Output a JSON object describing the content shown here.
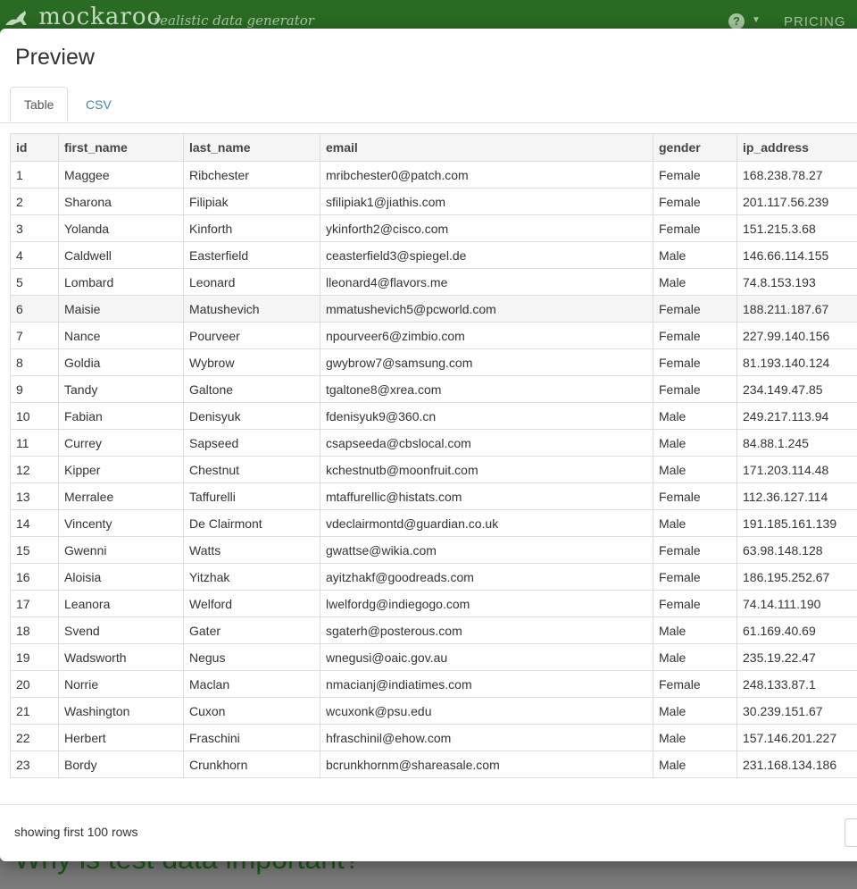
{
  "app": {
    "brand": "mockaroo",
    "tagline": "realistic data generator",
    "help_icon": "?",
    "pricing": "PRICING",
    "background_heading": "Why is test data important?"
  },
  "modal": {
    "title": "Preview",
    "tabs": [
      "Table",
      "CSV"
    ],
    "columns": [
      "id",
      "first_name",
      "last_name",
      "email",
      "gender",
      "ip_address"
    ],
    "rows": [
      [
        "1",
        "Maggee",
        "Ribchester",
        "mribchester0@patch.com",
        "Female",
        "168.238.78.27"
      ],
      [
        "2",
        "Sharona",
        "Filipiak",
        "sfilipiak1@jiathis.com",
        "Female",
        "201.117.56.239"
      ],
      [
        "3",
        "Yolanda",
        "Kinforth",
        "ykinforth2@cisco.com",
        "Female",
        "151.215.3.68"
      ],
      [
        "4",
        "Caldwell",
        "Easterfield",
        "ceasterfield3@spiegel.de",
        "Male",
        "146.66.114.155"
      ],
      [
        "5",
        "Lombard",
        "Leonard",
        "lleonard4@flavors.me",
        "Male",
        "74.8.153.193"
      ],
      [
        "6",
        "Maisie",
        "Matushevich",
        "mmatushevich5@pcworld.com",
        "Female",
        "188.211.187.67"
      ],
      [
        "7",
        "Nance",
        "Pourveer",
        "npourveer6@zimbio.com",
        "Female",
        "227.99.140.156"
      ],
      [
        "8",
        "Goldia",
        "Wybrow",
        "gwybrow7@samsung.com",
        "Female",
        "81.193.140.124"
      ],
      [
        "9",
        "Tandy",
        "Galtone",
        "tgaltone8@xrea.com",
        "Female",
        "234.149.47.85"
      ],
      [
        "10",
        "Fabian",
        "Denisyuk",
        "fdenisyuk9@360.cn",
        "Male",
        "249.217.113.94"
      ],
      [
        "11",
        "Currey",
        "Sapseed",
        "csapseeda@cbslocal.com",
        "Male",
        "84.88.1.245"
      ],
      [
        "12",
        "Kipper",
        "Chestnut",
        "kchestnutb@moonfruit.com",
        "Male",
        "171.203.114.48"
      ],
      [
        "13",
        "Merralee",
        "Taffurelli",
        "mtaffurellic@histats.com",
        "Female",
        "112.36.127.114"
      ],
      [
        "14",
        "Vincenty",
        "De Clairmont",
        "vdeclairmontd@guardian.co.uk",
        "Male",
        "191.185.161.139"
      ],
      [
        "15",
        "Gwenni",
        "Watts",
        "gwattse@wikia.com",
        "Female",
        "63.98.148.128"
      ],
      [
        "16",
        "Aloisia",
        "Yitzhak",
        "ayitzhakf@goodreads.com",
        "Female",
        "186.195.252.67"
      ],
      [
        "17",
        "Leanora",
        "Welford",
        "lwelfordg@indiegogo.com",
        "Female",
        "74.14.111.190"
      ],
      [
        "18",
        "Svend",
        "Gater",
        "sgaterh@posterous.com",
        "Male",
        "61.169.40.69"
      ],
      [
        "19",
        "Wadsworth",
        "Negus",
        "wnegusi@oaic.gov.au",
        "Male",
        "235.19.22.47"
      ],
      [
        "20",
        "Norrie",
        "Maclan",
        "nmacianj@indiatimes.com",
        "Female",
        "248.133.87.1"
      ],
      [
        "21",
        "Washington",
        "Cuxon",
        "wcuxonk@psu.edu",
        "Male",
        "30.239.151.67"
      ],
      [
        "22",
        "Herbert",
        "Fraschini",
        "hfraschinil@ehow.com",
        "Male",
        "157.146.201.227"
      ],
      [
        "23",
        "Bordy",
        "Crunkhorn",
        "bcrunkhornm@shareasale.com",
        "Male",
        "231.168.134.186"
      ]
    ],
    "footer_text": "showing first 100 rows"
  }
}
